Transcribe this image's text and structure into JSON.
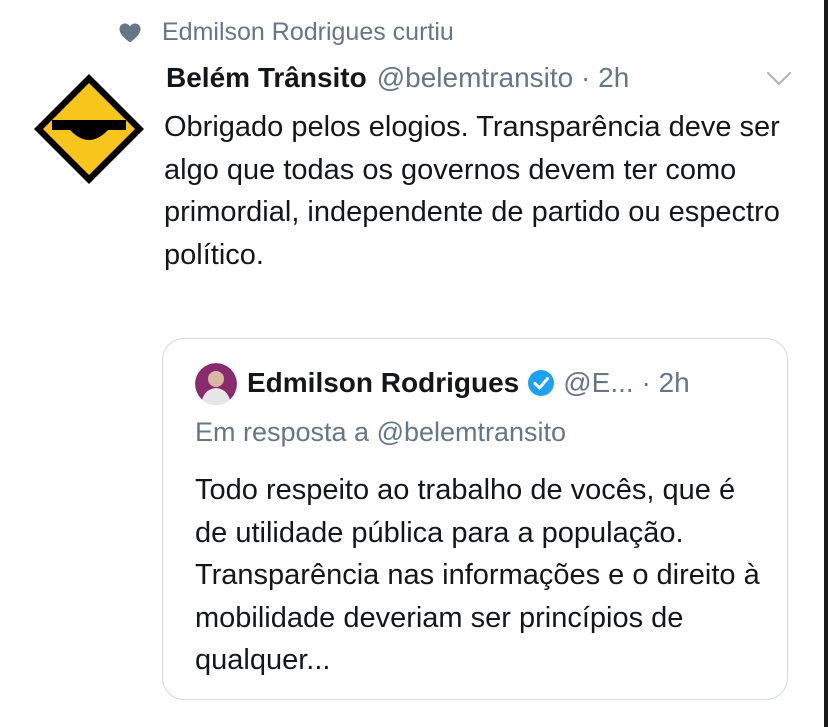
{
  "social_context": {
    "icon": "heart-icon",
    "text": "Edmilson Rodrigues curtiu"
  },
  "tweet": {
    "author_name": "Belém Trânsito",
    "handle_time": "@belemtransito · 2h",
    "text": "Obrigado pelos elogios. Transparência deve ser algo que todas os governos devem ter como primordial, independente de partido ou espectro político."
  },
  "quoted_tweet": {
    "author_name": "Edmilson Rodrigues",
    "handle_time": "@E... · 2h",
    "reply_to": "Em resposta a @belemtransito",
    "text": "Todo respeito ao trabalho de vocês, que é de utilidade pública para a população. Transparência nas informações e o direito à mobilidade deveriam ser princípios de qualquer..."
  },
  "colors": {
    "text": "#14171a",
    "secondary": "#657786",
    "border": "#cfd9de",
    "verified": "#1da1f2",
    "sign_yellow": "#f7c51c"
  }
}
